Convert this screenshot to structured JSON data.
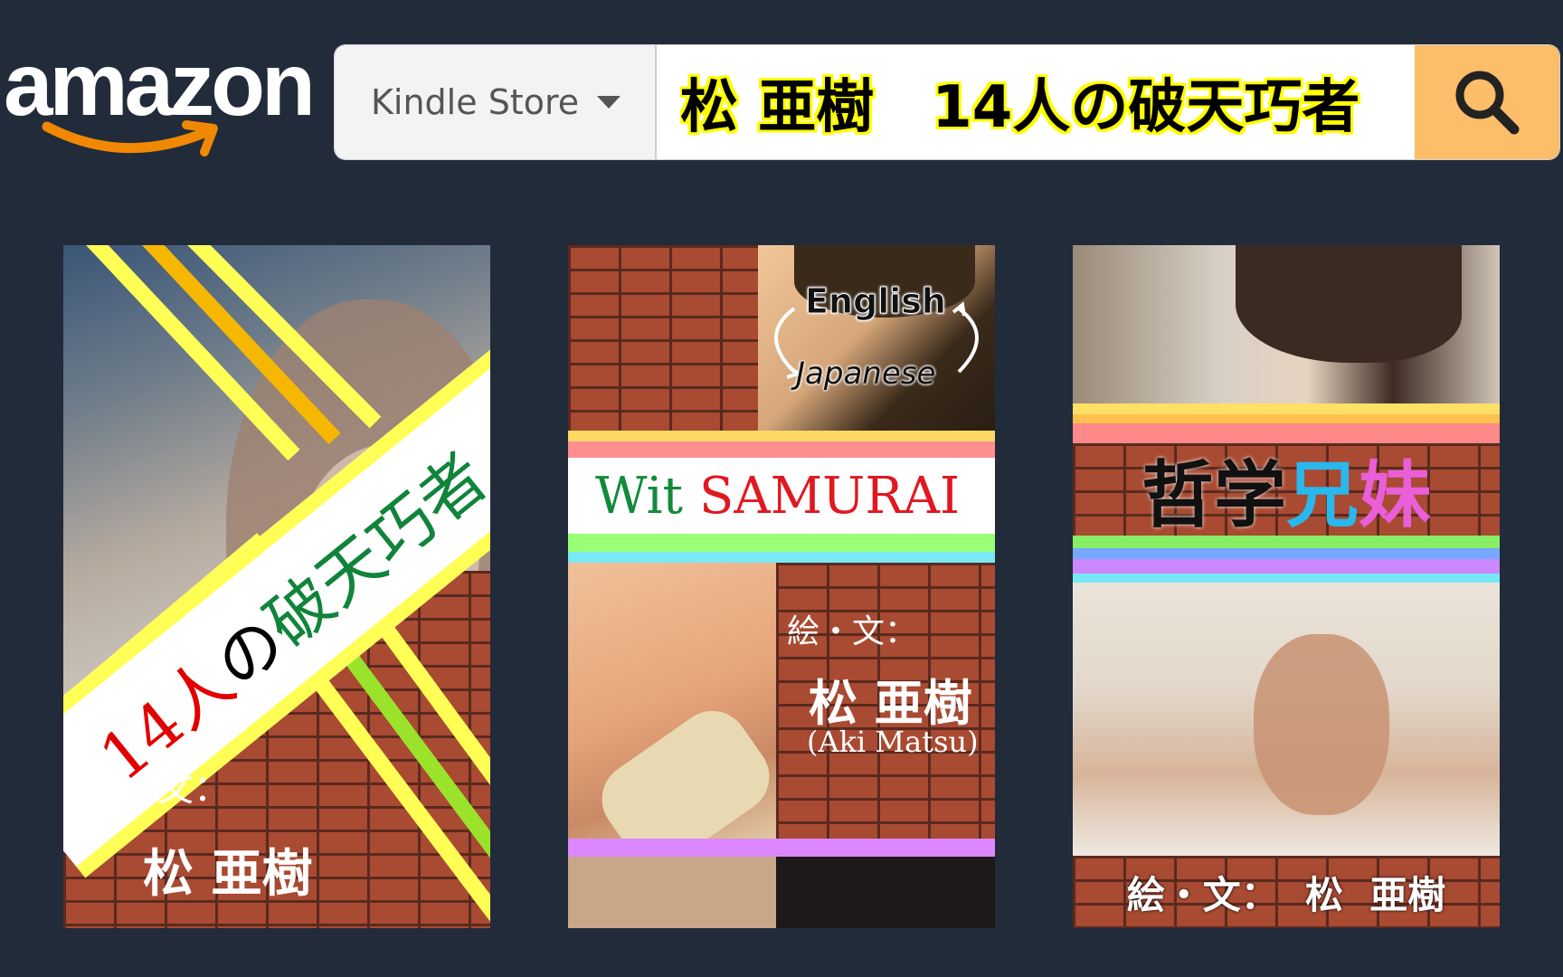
{
  "header": {
    "logo_text": "amazon",
    "department": "Kindle Store",
    "search_value": "松 亜樹　14人の破天巧者"
  },
  "colors": {
    "background": "#222b3a",
    "search_button": "#febd69",
    "logo_smile": "#f08804"
  },
  "books": [
    {
      "title_part1": "14人",
      "title_part2": "の",
      "title_part3": "破天巧者",
      "credit_label": "絵・文：",
      "author": "松 亜樹"
    },
    {
      "badge_top": "English",
      "badge_bottom": "Japanese",
      "title_part1": "Wit",
      "title_part2": "SAMURAI",
      "credit_label": "絵・文：",
      "author": "松 亜樹",
      "author_romaji": "(Aki Matsu)"
    },
    {
      "title_part1": "哲学",
      "title_part2": "兄",
      "title_part3": "妹",
      "credit": "絵・文：  松  亜樹"
    }
  ]
}
